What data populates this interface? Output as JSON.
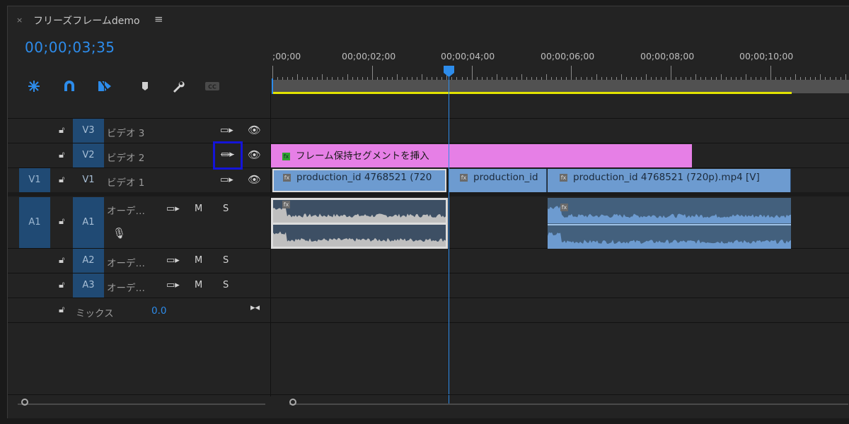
{
  "tab": {
    "close": "×",
    "title": "フリーズフレームdemo",
    "menu": "≡"
  },
  "timecode": "00;00;03;35",
  "ruler": {
    "labels": [
      ";00;00",
      "00;00;02;00",
      "00;00;04;00",
      "00;00;06;00",
      "00;00;08;00",
      "00;00;10;00"
    ]
  },
  "tracks": {
    "v3": {
      "label": "V3",
      "name": "ビデオ 3"
    },
    "v2": {
      "label": "V2",
      "name": "ビデオ 2"
    },
    "v1": {
      "target": "V1",
      "label": "V1",
      "name": "ビデオ 1"
    },
    "a1": {
      "target": "A1",
      "label": "A1",
      "name": "オーデ…",
      "mute": "M",
      "solo": "S"
    },
    "a2": {
      "label": "A2",
      "name": "オーデ…",
      "mute": "M",
      "solo": "S"
    },
    "a3": {
      "label": "A3",
      "name": "オーデ…",
      "mute": "M",
      "solo": "S"
    },
    "mix": {
      "name": "ミックス",
      "value": "0.0"
    }
  },
  "clips": {
    "pink": "フレーム保持セグメントを挿入",
    "v1a": "production_id 4768521 (720",
    "v1b": "production_id",
    "v1c": "production_id 4768521 (720p).mp4 [V]",
    "fx": "fx"
  },
  "colors": {
    "accent": "#2d8ceb",
    "pinkClip": "#e67fe6",
    "videoClip": "#6d9bd0",
    "audioClip": "#43607d",
    "workArea": "#e2e300",
    "highlight": "#1414d8"
  }
}
